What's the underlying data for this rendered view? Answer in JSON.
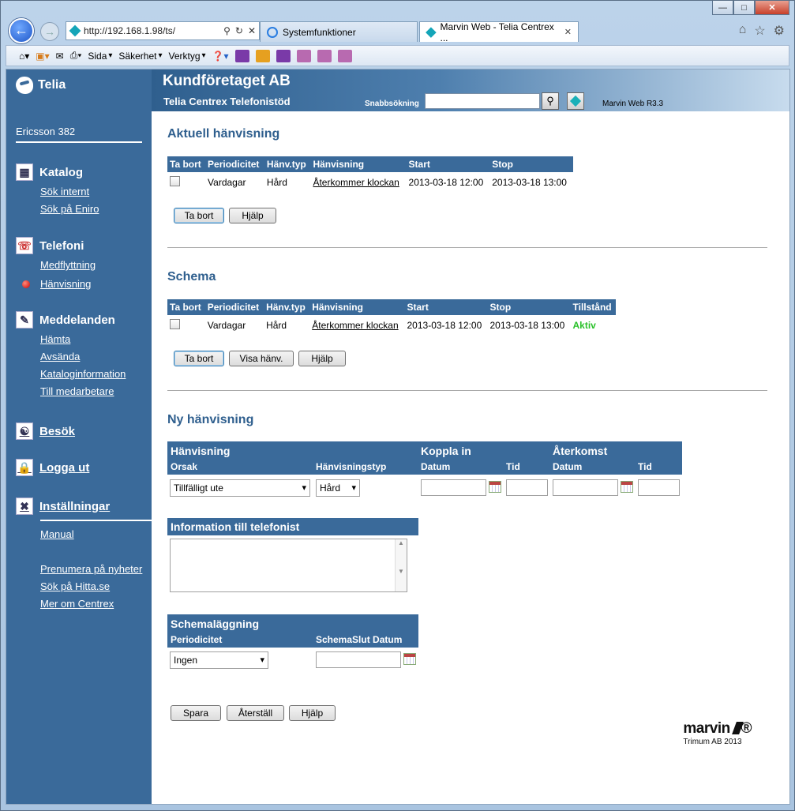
{
  "browser": {
    "address": "http://192.168.1.98/ts/",
    "tabs": [
      {
        "label": "Systemfunktioner"
      },
      {
        "label": "Marvin Web - Telia Centrex ..."
      }
    ],
    "cmd": {
      "sida": "Sida",
      "sakerhet": "Säkerhet",
      "verktyg": "Verktyg"
    }
  },
  "header": {
    "brand": "Telia",
    "company": "Kundföretaget AB",
    "subtitle": "Telia Centrex Telefonistöd",
    "quick_search_label": "Snabbsökning",
    "version": "Marvin Web R3.3"
  },
  "sidebar": {
    "user": "Ericsson 382",
    "katalog": {
      "title": "Katalog",
      "links": [
        "Sök internt",
        "Sök på Eniro"
      ]
    },
    "telefoni": {
      "title": "Telefoni",
      "links": [
        "Medflyttning",
        "Hänvisning"
      ]
    },
    "meddelanden": {
      "title": "Meddelanden",
      "links": [
        "Hämta",
        "Avsända",
        "Kataloginformation",
        "Till medarbetare"
      ]
    },
    "besok": "Besök",
    "logga_ut": "Logga ut",
    "installningar": "Inställningar",
    "manual": "Manual",
    "extra": [
      "Prenumera på nyheter",
      "Sök på Hitta.se",
      "Mer om Centrex"
    ]
  },
  "aktuell": {
    "title": "Aktuell hänvisning",
    "headers": [
      "Ta bort",
      "Periodicitet",
      "Hänv.typ",
      "Hänvisning",
      "Start",
      "Stop"
    ],
    "row": {
      "periodicitet": "Vardagar",
      "typ": "Hård",
      "hanvisning": "Återkommer klockan",
      "start": "2013-03-18 12:00",
      "stop": "2013-03-18 13:00"
    },
    "btn_remove": "Ta bort",
    "btn_help": "Hjälp"
  },
  "schema": {
    "title": "Schema",
    "headers": [
      "Ta bort",
      "Periodicitet",
      "Hänv.typ",
      "Hänvisning",
      "Start",
      "Stop",
      "Tillstånd"
    ],
    "row": {
      "periodicitet": "Vardagar",
      "typ": "Hård",
      "hanvisning": "Återkommer klockan",
      "start": "2013-03-18 12:00",
      "stop": "2013-03-18 13:00",
      "state": "Aktiv"
    },
    "btn_remove": "Ta bort",
    "btn_show": "Visa hänv.",
    "btn_help": "Hjälp"
  },
  "ny": {
    "title": "Ny hänvisning",
    "hanvisning": "Hänvisning",
    "orsak": "Orsak",
    "hanvisningstyp": "Hänvisningstyp",
    "koppla_in": "Koppla in",
    "aterkomst": "Återkomst",
    "datum": "Datum",
    "tid": "Tid",
    "orsak_value": "Tillfälligt ute",
    "typ_value": "Hård",
    "info_title": "Information till telefonist",
    "schemalaggning": "Schemaläggning",
    "periodicitet": "Periodicitet",
    "schema_slut": "SchemaSlut Datum",
    "periodicitet_value": "Ingen",
    "btn_save": "Spara",
    "btn_reset": "Återställ",
    "btn_help": "Hjälp"
  },
  "footer": {
    "brand": "marvin",
    "copyright": "Trimum AB 2013"
  }
}
